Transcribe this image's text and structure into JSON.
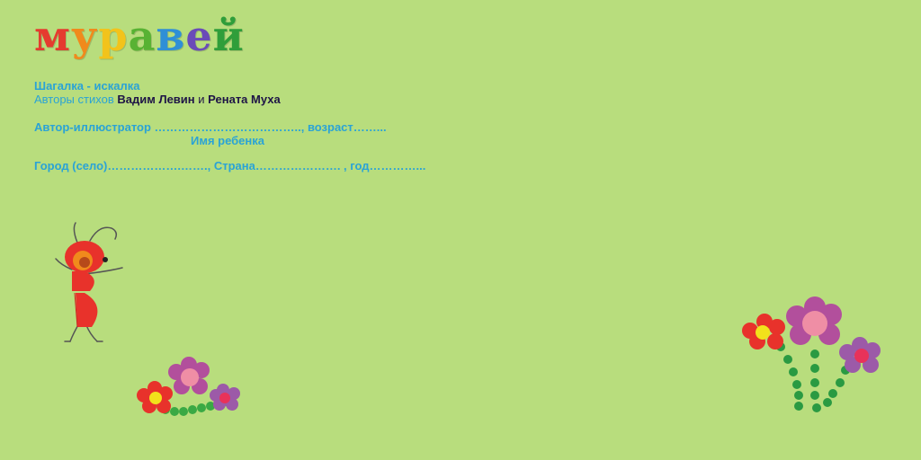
{
  "title": "муравей",
  "title_letters": [
    "м",
    "у",
    "р",
    "а",
    "в",
    "е",
    "й"
  ],
  "title_colors": [
    "#e53b2f",
    "#f08a1c",
    "#f2c31b",
    "#58b233",
    "#2f8fd6",
    "#6a4bb8",
    "#2f9e3a"
  ],
  "poem": {
    "name": "Шагалка - искалка",
    "authors_label": "Авторы стихов",
    "author1": "Вадим  Левин",
    "conjunction": "и",
    "author2": "Рената  Муха"
  },
  "form": {
    "illustrator_line": "Автор-иллюстратор ……………………………….., возраст……...",
    "child_name_caption": "Имя ребенка",
    "location_line": "Город (село)……………….…….,  Страна…………………. , год…………..."
  },
  "colors": {
    "background": "#b8dd7d",
    "text_blue": "#2aa3d6",
    "text_dark": "#1e1446",
    "ant_red": "#e8322b"
  }
}
